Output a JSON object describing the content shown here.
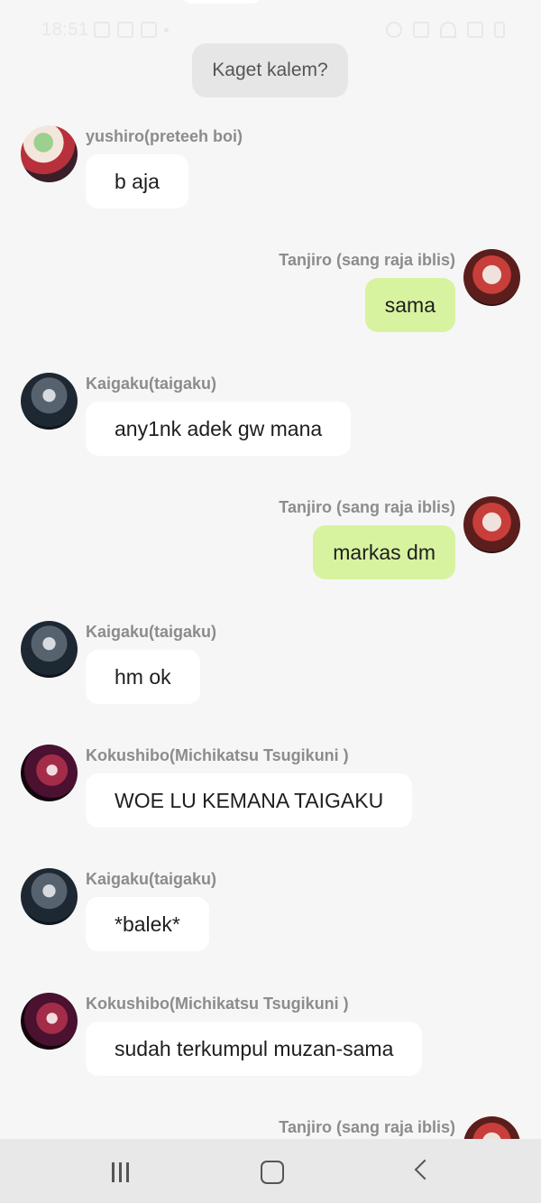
{
  "status_bar": {
    "time": "18:51"
  },
  "system_message": "Kaget kalem?",
  "messages": [
    {
      "sender": "yushiro(preteeh boi)",
      "text": "b aja",
      "side": "in",
      "avatar": "yushiro-avatar"
    },
    {
      "sender": "Tanjiro (sang raja iblis)",
      "text": "sama",
      "side": "out",
      "avatar": "tanjiro-avatar"
    },
    {
      "sender": "Kaigaku(taigaku)",
      "text": "any1nk adek gw mana",
      "side": "in",
      "avatar": "kaigaku-avatar"
    },
    {
      "sender": "Tanjiro (sang raja iblis)",
      "text": "markas dm",
      "side": "out",
      "avatar": "tanjiro-avatar"
    },
    {
      "sender": "Kaigaku(taigaku)",
      "text": "hm ok",
      "side": "in",
      "avatar": "kaigaku-avatar"
    },
    {
      "sender": "Kokushibo(Michikatsu Tsugikuni )",
      "text": "WOE LU KEMANA TAIGAKU",
      "side": "in",
      "avatar": "kokushibo-avatar"
    },
    {
      "sender": "Kaigaku(taigaku)",
      "text": "*balek*",
      "side": "in",
      "avatar": "kaigaku-avatar"
    },
    {
      "sender": "Kokushibo(Michikatsu Tsugikuni )",
      "text": "sudah terkumpul muzan-sama",
      "side": "in",
      "avatar": "kokushibo-avatar"
    },
    {
      "sender": "Tanjiro (sang raja iblis)",
      "text": "",
      "side": "out",
      "avatar": "tanjiro-avatar"
    }
  ],
  "nav": {
    "recents": "recents-icon",
    "home": "home-icon",
    "back": "back-icon"
  },
  "colors": {
    "background": "#f6f6f6",
    "incoming_bubble": "#ffffff",
    "outgoing_bubble": "#d7f3a0",
    "sender_name": "#8c8c8c",
    "system_pill": "#e6e6e6"
  }
}
